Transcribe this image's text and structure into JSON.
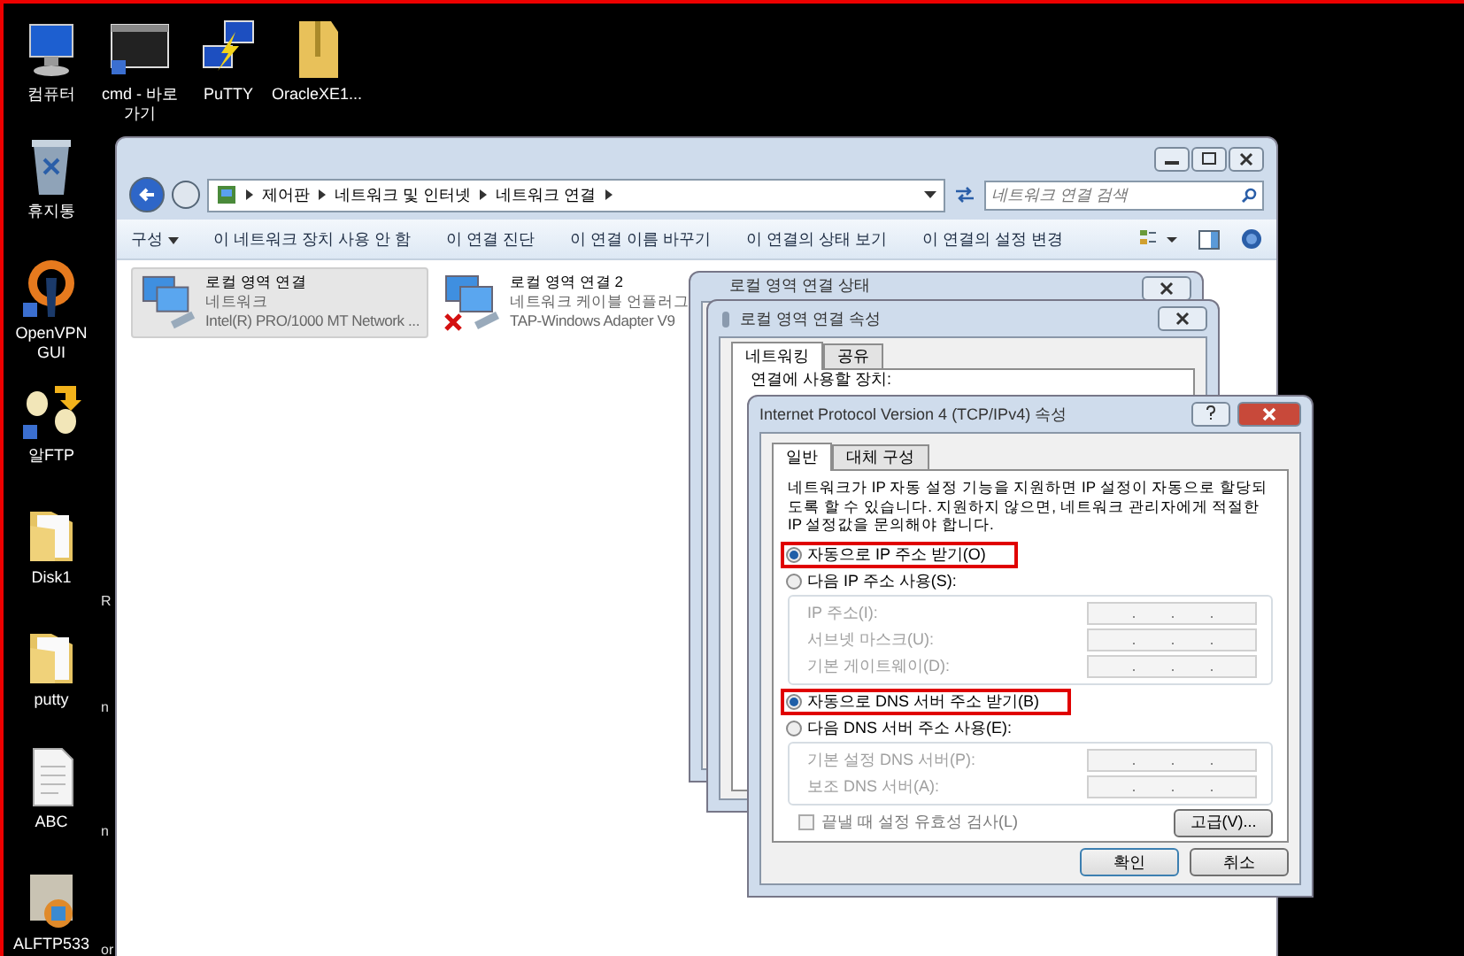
{
  "desktop_top_icons": [
    {
      "label": "컴퓨터",
      "kind": "computer"
    },
    {
      "label": "cmd - 바로 가기",
      "kind": "console"
    },
    {
      "label": "PuTTY",
      "kind": "putty"
    },
    {
      "label": "OracleXE1...",
      "kind": "zip-folder"
    }
  ],
  "desktop_left_icons": [
    {
      "label": "휴지통",
      "kind": "recycle-bin"
    },
    {
      "label": "OpenVPN GUI",
      "kind": "openvpn"
    },
    {
      "label": "알FTP",
      "kind": "ftp"
    },
    {
      "label": "Disk1",
      "kind": "folder"
    },
    {
      "label": "putty",
      "kind": "folder"
    },
    {
      "label": "ABC",
      "kind": "document"
    },
    {
      "label": "ALFTP533",
      "kind": "installer"
    }
  ],
  "partial_labels": [
    "R",
    "n",
    "n",
    "or"
  ],
  "explorer": {
    "breadcrumb": [
      "제어판",
      "네트워크 및 인터넷",
      "네트워크 연결"
    ],
    "search": {
      "placeholder": "네트워크 연결 검색"
    },
    "toolbar": [
      {
        "label": "구성",
        "kind": "menu"
      },
      {
        "label": "이 네트워크 장치 사용 안 함",
        "kind": "command"
      },
      {
        "label": "이 연결 진단",
        "kind": "command"
      },
      {
        "label": "이 연결 이름 바꾸기",
        "kind": "command"
      },
      {
        "label": "이 연결의 상태 보기",
        "kind": "command"
      },
      {
        "label": "이 연결의 설정 변경",
        "kind": "command"
      }
    ],
    "connections": [
      {
        "name": "로컬 영역 연결",
        "status": "네트워크",
        "adapter": "Intel(R) PRO/1000 MT Network ...",
        "selected": true,
        "disconnected": false
      },
      {
        "name": "로컬 영역 연결 2",
        "status": "네트워크 케이블 언플러그",
        "adapter": "TAP-Windows Adapter V9",
        "selected": false,
        "disconnected": true
      }
    ]
  },
  "status_dialog": {
    "title": "로컬 영역 연결 상태"
  },
  "properties_dialog": {
    "title": "로컬 영역 연결 속성",
    "tabs": [
      {
        "label": "네트워킹",
        "selected": true
      },
      {
        "label": "공유",
        "selected": false
      }
    ],
    "device_label": "연결에 사용할 장치:"
  },
  "ipv4_dialog": {
    "title": "Internet Protocol Version 4 (TCP/IPv4) 속성",
    "tabs": [
      {
        "label": "일반",
        "selected": true
      },
      {
        "label": "대체 구성",
        "selected": false
      }
    ],
    "description": "네트워크가 IP 자동 설정 기능을 지원하면 IP 설정이 자동으로 할당되도록 할 수 있습니다. 지원하지 않으면, 네트워크 관리자에게 적절한 IP 설정값을 문의해야 합니다.",
    "ip_mode": [
      {
        "label": "자동으로 IP 주소 받기(O)",
        "selected": true,
        "highlighted": true
      },
      {
        "label": "다음 IP 주소 사용(S):",
        "selected": false,
        "highlighted": false
      }
    ],
    "ip_fields": [
      {
        "label": "IP 주소(I):",
        "disabled": true
      },
      {
        "label": "서브넷 마스크(U):",
        "disabled": true
      },
      {
        "label": "기본 게이트웨이(D):",
        "disabled": true
      }
    ],
    "dns_mode": [
      {
        "label": "자동으로 DNS 서버 주소 받기(B)",
        "selected": true,
        "highlighted": true
      },
      {
        "label": "다음 DNS 서버 주소 사용(E):",
        "selected": false,
        "highlighted": false
      }
    ],
    "dns_fields": [
      {
        "label": "기본 설정 DNS 서버(P):",
        "disabled": true
      },
      {
        "label": "보조 DNS 서버(A):",
        "disabled": true
      }
    ],
    "validate": {
      "label": "끝낼 때 설정 유효성 검사(L)",
      "checked": false,
      "disabled": true
    },
    "advanced_button": "고급(V)...",
    "buttons": [
      "확인",
      "취소"
    ]
  }
}
